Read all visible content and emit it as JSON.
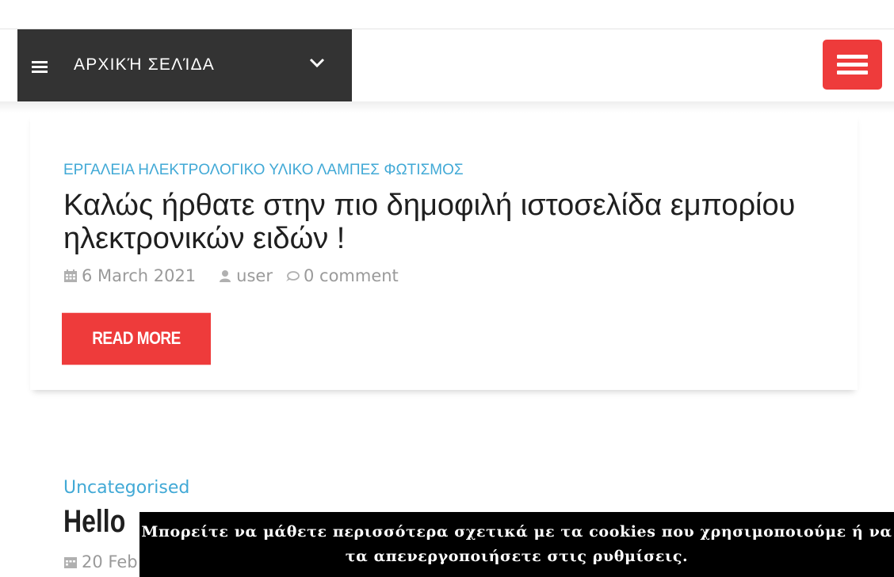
{
  "nav": {
    "menu_label": "ΑΡΧΙΚΉ ΣΕΛΊΔΑ",
    "menu_icon": "hamburger-icon",
    "chevron_icon": "chevron-down-icon",
    "toggle_icon": "hamburger-icon",
    "toggle_color": "#ee3b3b",
    "bar_color": "#333333"
  },
  "post1": {
    "categories": "ΕΡΓΑΛΕΙΑ ΗΛΕΚΤΡΟΛΟΓΙΚΟ ΥΛΙΚΟ ΛΑΜΠΕΣ ΦΩΤΙΣΜΟΣ",
    "title": "Καλώς ήρθατε στην πιο δημοφιλή ιστοσελίδα εμπορίου ηλεκτρονικών ειδών !",
    "date": "6 March 2021",
    "author": "user",
    "comments": "0 comment",
    "read_more": "READ MORE"
  },
  "post2": {
    "categories": "Uncategorised",
    "title": "Hello",
    "date": "20 Feb"
  },
  "cookie_banner": {
    "text": "Μπορείτε να μάθετε περισσότερα σχετικά με τα cookies που χρησιμοποιούμε ή να τα απενεργοποιήσετε στις ρυθμίσεις."
  },
  "colors": {
    "accent_red": "#ee3b3b",
    "category_blue": "#41a9d6",
    "meta_gray": "#9a9a9a"
  }
}
